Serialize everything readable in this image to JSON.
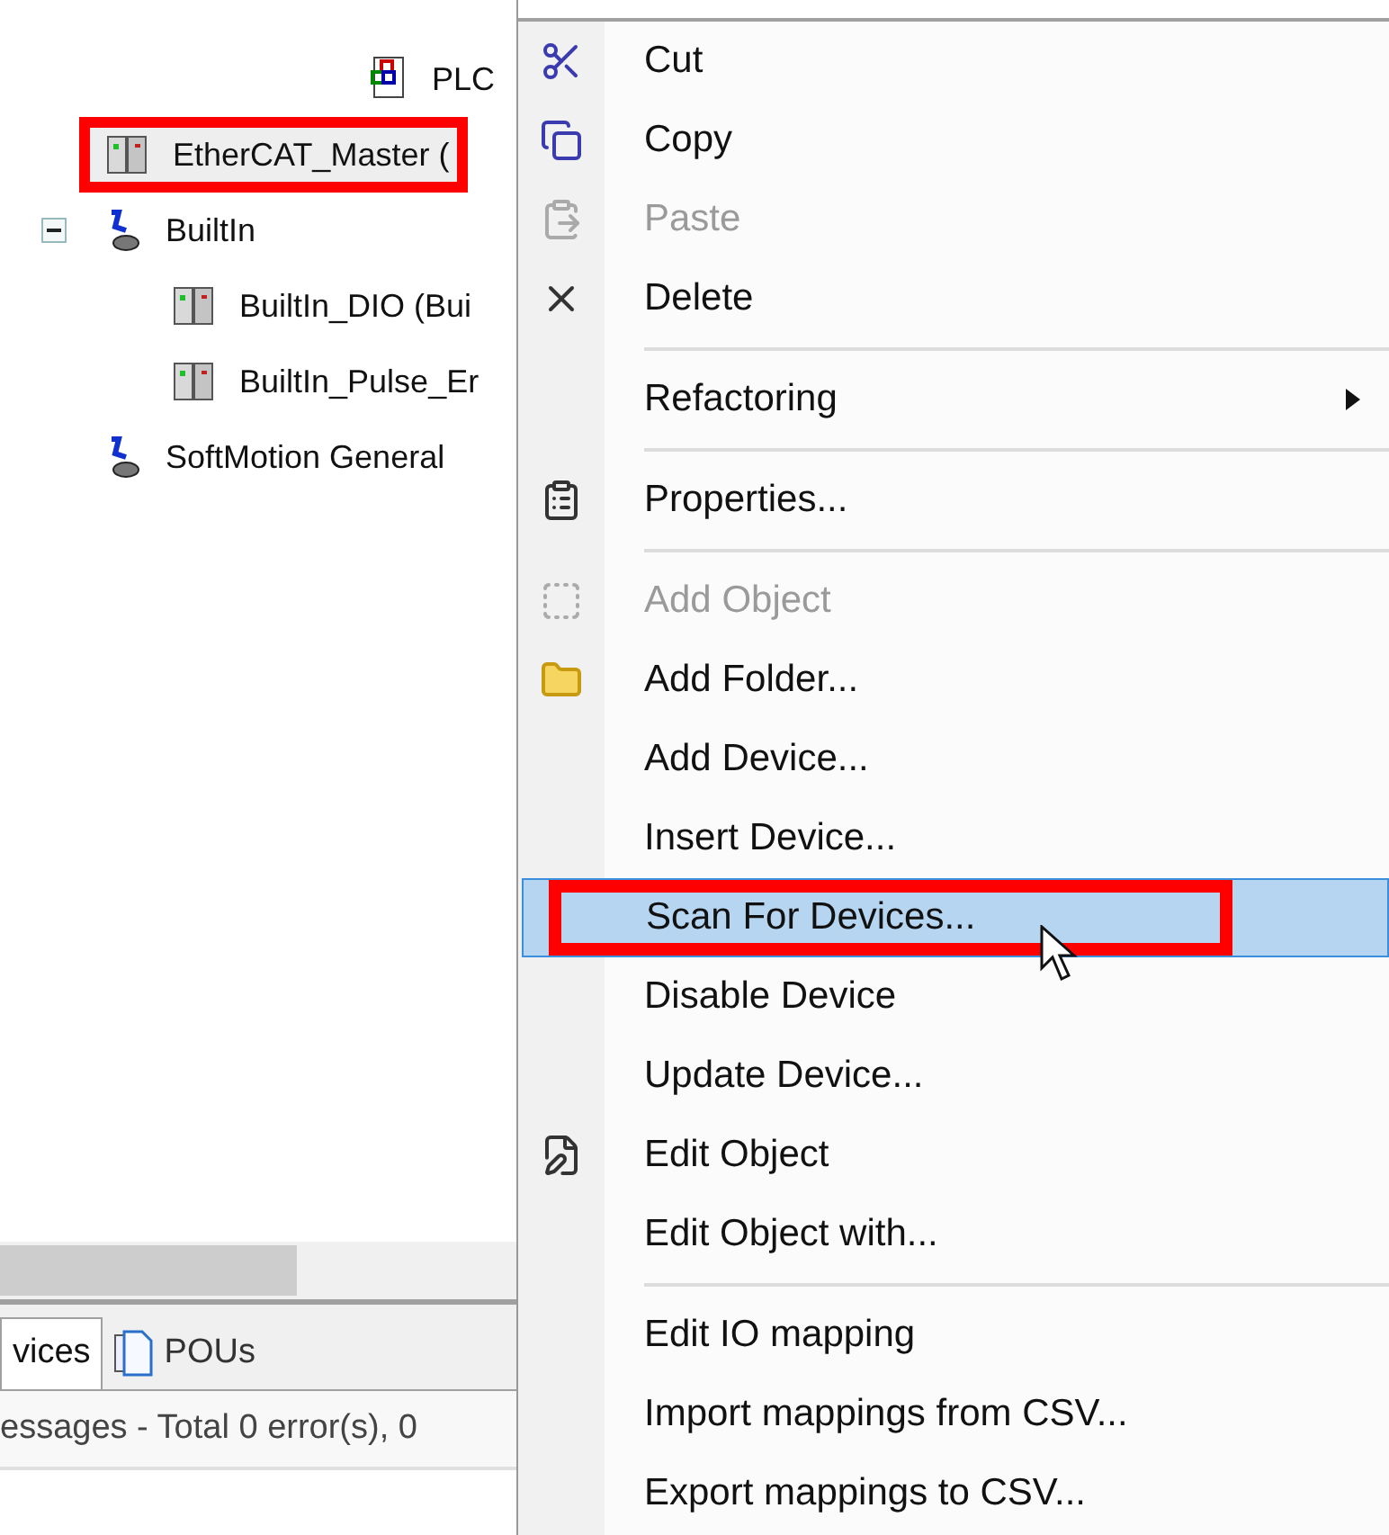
{
  "tree": {
    "above": [
      {
        "label": "PLC",
        "kind": "program",
        "annotated": false
      }
    ],
    "items": [
      {
        "label": "EtherCAT_Master (",
        "kind": "device",
        "annotated": true
      },
      {
        "label": "BuiltIn",
        "kind": "bus",
        "annotated": false,
        "expanded": true,
        "children": [
          {
            "label": "BuiltIn_DIO (Bui",
            "kind": "device",
            "annotated": false
          },
          {
            "label": "BuiltIn_Pulse_Er",
            "kind": "device",
            "annotated": false
          }
        ]
      },
      {
        "label": "SoftMotion General",
        "kind": "bus",
        "annotated": false
      }
    ]
  },
  "bottom_tabs": [
    {
      "label": "vices",
      "selected": true
    },
    {
      "label": "POUs",
      "selected": false
    }
  ],
  "messages": "essages - Total 0 error(s), 0",
  "context_menu": [
    {
      "kind": "item",
      "label": "Cut",
      "disabled": false,
      "selected": false,
      "annotated": false
    },
    {
      "kind": "item",
      "label": "Copy",
      "disabled": false,
      "selected": false,
      "annotated": false
    },
    {
      "kind": "item",
      "label": "Paste",
      "disabled": true,
      "selected": false,
      "annotated": false
    },
    {
      "kind": "item",
      "label": "Delete",
      "disabled": false,
      "selected": false,
      "annotated": false
    },
    {
      "kind": "separator"
    },
    {
      "kind": "submenu",
      "label": "Refactoring",
      "disabled": false,
      "selected": false,
      "annotated": false
    },
    {
      "kind": "separator"
    },
    {
      "kind": "item",
      "label": "Properties...",
      "disabled": false,
      "selected": false,
      "annotated": false
    },
    {
      "kind": "separator"
    },
    {
      "kind": "item",
      "label": "Add Object",
      "disabled": true,
      "selected": false,
      "annotated": false
    },
    {
      "kind": "item",
      "label": "Add Folder...",
      "disabled": false,
      "selected": false,
      "annotated": false
    },
    {
      "kind": "item",
      "label": "Add Device...",
      "disabled": false,
      "selected": false,
      "annotated": false
    },
    {
      "kind": "item",
      "label": "Insert Device...",
      "disabled": false,
      "selected": false,
      "annotated": false
    },
    {
      "kind": "item",
      "label": "Scan For Devices...",
      "disabled": false,
      "selected": true,
      "annotated": true
    },
    {
      "kind": "item",
      "label": "Disable Device",
      "disabled": false,
      "selected": false,
      "annotated": false
    },
    {
      "kind": "item",
      "label": "Update Device...",
      "disabled": false,
      "selected": false,
      "annotated": false
    },
    {
      "kind": "item",
      "label": "Edit Object",
      "disabled": false,
      "selected": false,
      "annotated": false
    },
    {
      "kind": "item",
      "label": "Edit Object with...",
      "disabled": false,
      "selected": false,
      "annotated": false
    },
    {
      "kind": "separator"
    },
    {
      "kind": "item",
      "label": "Edit IO mapping",
      "disabled": false,
      "selected": false,
      "annotated": false
    },
    {
      "kind": "item",
      "label": "Import mappings from CSV...",
      "disabled": false,
      "selected": false,
      "annotated": false
    },
    {
      "kind": "item",
      "label": "Export mappings to CSV...",
      "disabled": false,
      "selected": false,
      "annotated": false
    }
  ]
}
